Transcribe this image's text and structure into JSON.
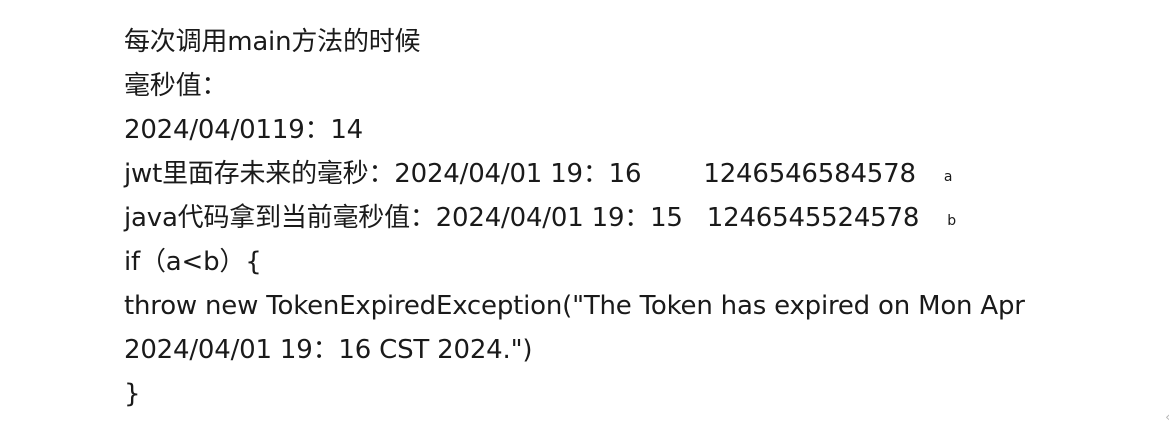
{
  "document": {
    "line1": "每次调用main方法的时候",
    "line2": "毫秒值：",
    "line3": "2024/04/0119：14",
    "line4": {
      "text": "jwt里面存未来的毫秒：2024/04/01 19：16",
      "value": "1246546584578",
      "marker": "a"
    },
    "line5": {
      "text": "java代码拿到当前毫秒值：2024/04/01 19：15",
      "value": "1246545524578",
      "marker": "b"
    },
    "line6": "if（a<b）{",
    "line7": "throw new TokenExpiredException(\"The Token has expired on Mon Apr",
    "line8": "2024/04/01 19：16 CST 2024.\")",
    "line9": "}"
  }
}
